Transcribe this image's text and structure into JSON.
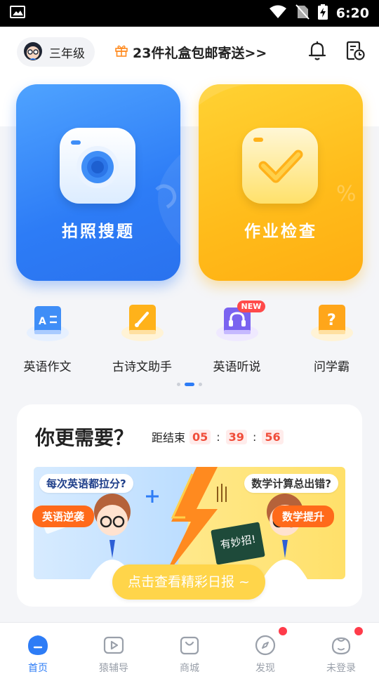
{
  "status_bar": {
    "time": "6:20"
  },
  "header": {
    "grade": "三年级",
    "promo": "23件礼盒包邮寄送>>",
    "bell_icon": "bell-icon",
    "schedule_icon": "calendar-clock-icon"
  },
  "hero": [
    {
      "label": "拍照搜题",
      "icon": "camera-icon",
      "color": "#2d7cf6"
    },
    {
      "label": "作业检查",
      "icon": "checkmark-icon",
      "color": "#ffbb1a"
    }
  ],
  "tools": [
    {
      "label": "英语作文",
      "icon": "book-az-icon"
    },
    {
      "label": "古诗文助手",
      "icon": "brush-book-icon"
    },
    {
      "label": "英语听说",
      "icon": "headset-icon",
      "badge": "NEW"
    },
    {
      "label": "问学霸",
      "icon": "question-book-icon"
    }
  ],
  "pager": {
    "count": 3,
    "active": 1
  },
  "needs": {
    "title": "你更需要？",
    "countdown_label": "距结束",
    "hours": "05",
    "minutes": "39",
    "seconds": "56",
    "banner": {
      "left_question": "每次英语都拉分?",
      "right_question": "数学计算总出错?",
      "left_button": "英语逆袭",
      "right_button": "数学提升",
      "board_text": "有妙招!",
      "center_button": "点击查看精彩日报 ~"
    }
  },
  "tabbar": [
    {
      "label": "首页",
      "icon": "home-icon",
      "active": true
    },
    {
      "label": "猿辅导",
      "icon": "play-icon"
    },
    {
      "label": "商城",
      "icon": "shopping-bag-icon"
    },
    {
      "label": "发现",
      "icon": "compass-icon",
      "dot": true
    },
    {
      "label": "未登录",
      "icon": "profile-face-icon",
      "dot": true
    }
  ],
  "colors": {
    "accent": "#2d7cf6",
    "warning": "#ff6a1a",
    "countdown": "#f04d3a"
  }
}
